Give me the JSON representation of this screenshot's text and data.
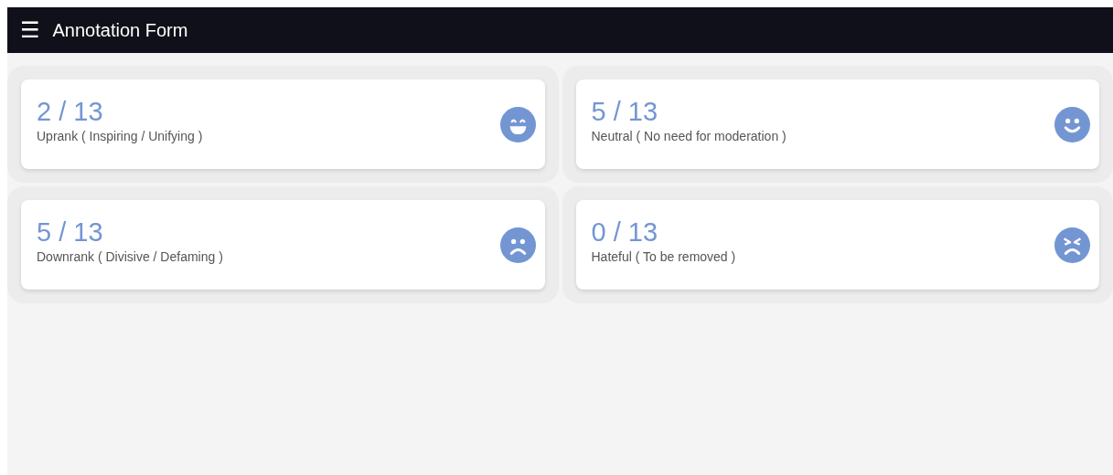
{
  "app_bar": {
    "menu_icon": "☰",
    "title": "Annotation Form"
  },
  "cards": [
    {
      "count": "2 / 13",
      "label": "Uprank ( Inspiring / Unifying )",
      "kind": "laughing"
    },
    {
      "count": "5 / 13",
      "label": "Neutral ( No need for moderation )",
      "kind": "smiling"
    },
    {
      "count": "5 / 13",
      "label": "Downrank ( Divisive / Defaming )",
      "kind": "frowning"
    },
    {
      "count": "0 / 13",
      "label": "Hateful ( To be removed )",
      "kind": "angry"
    }
  ]
}
